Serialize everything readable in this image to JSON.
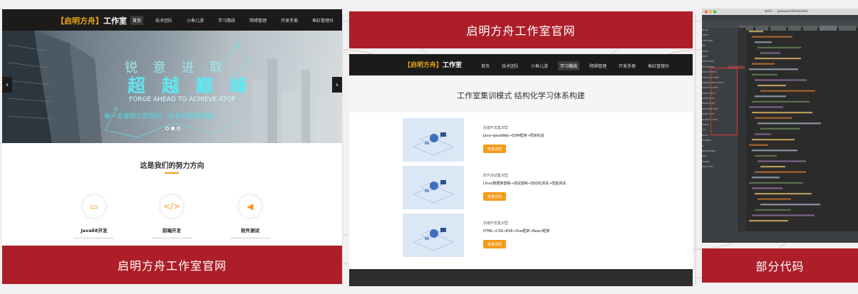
{
  "panel1": {
    "nav": {
      "logo_bracket": "【启明方舟】",
      "logo_text": "工作室",
      "items": [
        "首页",
        "技术团队",
        "小鱼儿游",
        "学习路线",
        "障碍管理",
        "开发手册",
        "鱼缸管理台"
      ],
      "active_index": 0
    },
    "hero": {
      "line1": "锐 意 进 取",
      "line2": "超 越 巅 峰",
      "line3": "FORGE AHEAD TO ACHIEVE ATOP",
      "line4": "每一支奋努力的背后，必有加倍的赏赐",
      "prev_arrow": "‹",
      "next_arrow": "›",
      "active_dot": 1,
      "dot_count": 3
    },
    "section_title": "这是我们的努力方向",
    "features": [
      {
        "icon": "laptop-icon",
        "glyph": "▭",
        "title": "JavaEE开发"
      },
      {
        "icon": "code-icon",
        "glyph": "</>",
        "title": "前端开发"
      },
      {
        "icon": "megaphone-icon",
        "glyph": "◀",
        "title": "软件测试"
      }
    ],
    "caption": "启明方舟工作室官网"
  },
  "panel2": {
    "header_caption": "启明方舟工作室官网",
    "nav": {
      "logo_bracket": "【启明方舟】",
      "logo_text": "工作室",
      "items": [
        "首页",
        "技术团队",
        "小鱼儿游",
        "学习路线",
        "障碍管理",
        "开发手册",
        "鱼缸管理台"
      ],
      "active_index": 3
    },
    "banner_title": "工作室集训模式 结构化学习体系构建",
    "courses": [
      {
        "title": "后端开发集训营",
        "desc": "Java→JavaWeb→SSM框架→项目实战",
        "button": "查看详情"
      },
      {
        "title": "软件测试集训营",
        "desc": "Linux数据库基础→测试基础→自动化测试→性能测试",
        "button": "查看详情"
      },
      {
        "title": "前端开发集训营",
        "desc": "HTML→CSS→ES6→Vue框架→React框架",
        "button": "查看详情"
      }
    ]
  },
  "panel3": {
    "window_title": "qmfz - ...\\passportal\\template\\",
    "highlight_label": "前端页面模板",
    "tree_items": [
      "qmfz",
      "  .idea",
      "  .settings",
      "  src",
      "    main",
      "      java",
      "      resources",
      "        templates",
      "          course.html",
      "          common.html",
      "          cooperation.html",
      "          course2.html",
      "          index.html",
      "          news.html",
      "          team.html",
      "          teamlist.html",
      "          tools.html",
      "          product.html",
      "      static",
      "        css",
      "        fonts",
      "        images",
      "        js",
      "      application",
      "    test",
      "  target",
      "  pom.xml"
    ],
    "caption": "部分代码"
  },
  "colors": {
    "red_bar": "#ad1e28",
    "accent_orange": "#f39b1b",
    "nav_bg": "#1b1b1b",
    "ide_bg": "#2b2b2b"
  }
}
